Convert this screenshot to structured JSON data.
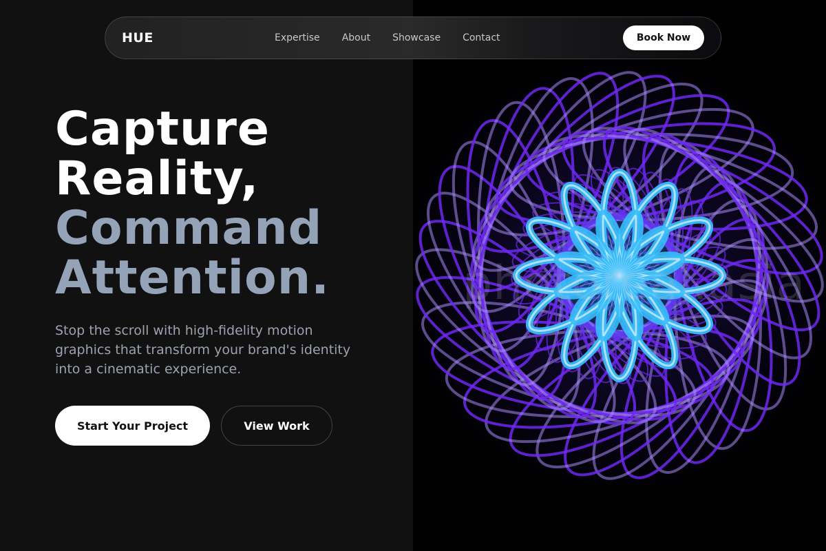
{
  "nav": {
    "brand": "HUE",
    "links": [
      "Expertise",
      "About",
      "Showcase",
      "Contact"
    ],
    "cta": "Book Now"
  },
  "hero": {
    "headline": [
      "Capture",
      "Reality,",
      "Command",
      "Attention."
    ],
    "subtext": "Stop the scroll with high-fidelity motion graphics that transform your brand's identity into a cinematic experience.",
    "primary_cta": "Start Your Project",
    "secondary_cta": "View Work"
  },
  "visual": {
    "watermark": "photoreal.asia",
    "colors": {
      "ring": "#6d28f0",
      "ring_highlight": "#a78bfa",
      "flower": "#38bdf8",
      "flower_highlight": "#bae6fd",
      "background": "#000000"
    }
  },
  "colors": {
    "page_bg": "#111111",
    "headline_white": "#ffffff",
    "headline_muted": "#94a3b8",
    "subtext": "#9ca3af"
  }
}
